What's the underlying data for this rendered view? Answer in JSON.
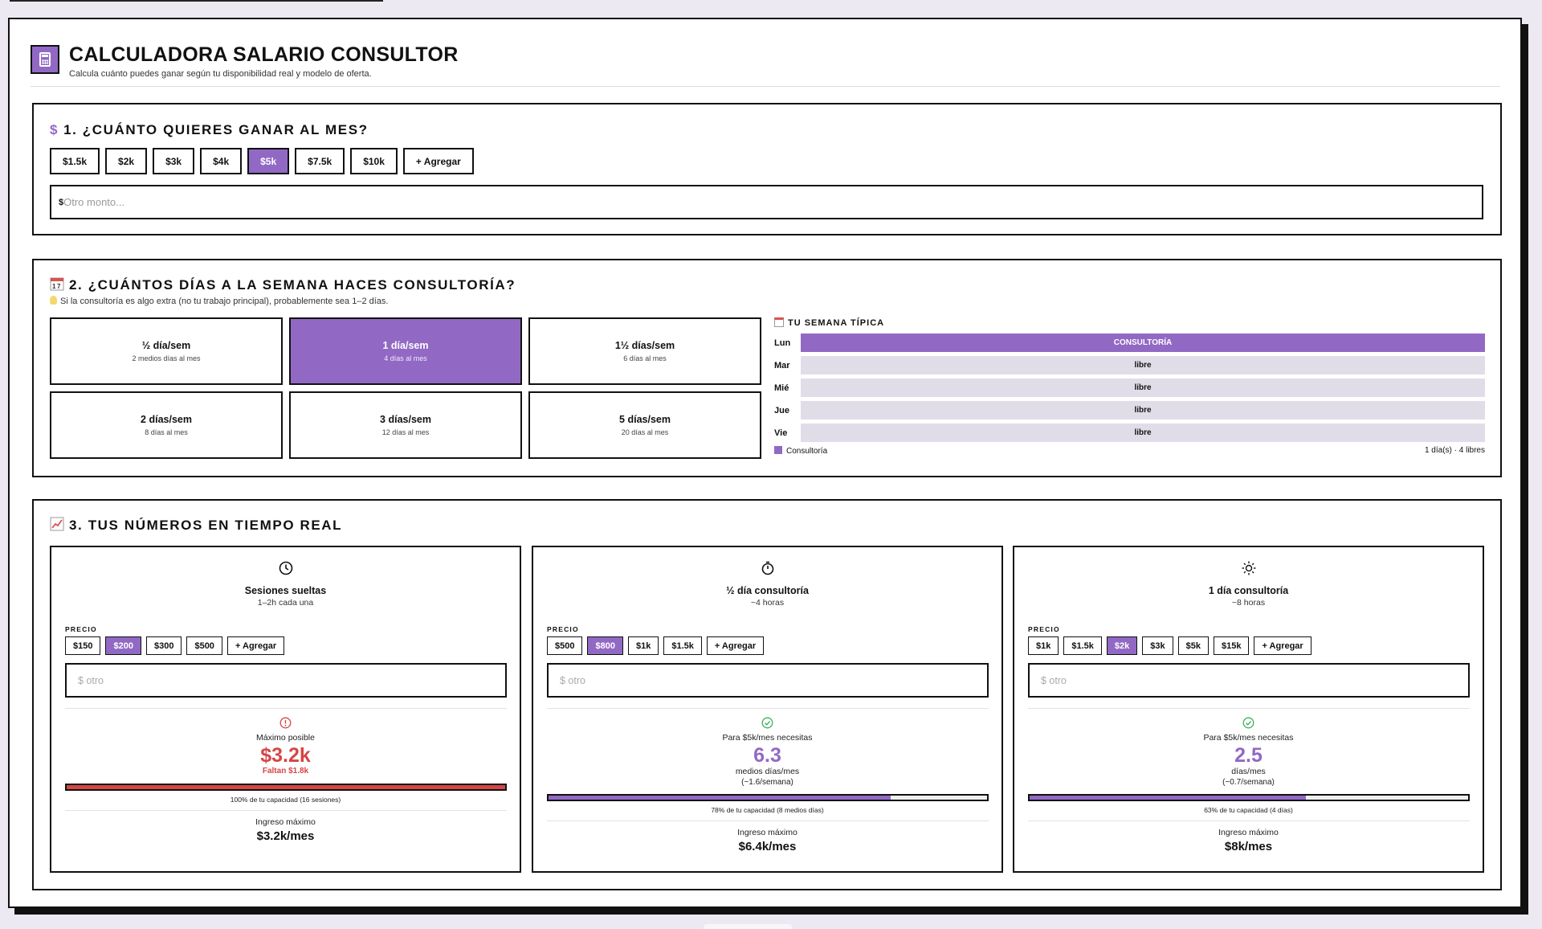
{
  "header": {
    "title": "CALCULADORA SALARIO CONSULTOR",
    "subtitle": "Calcula cuánto puedes ganar según tu disponibilidad real y modelo de oferta."
  },
  "section1": {
    "icon": "$",
    "title": "1. ¿CUÁNTO QUIERES GANAR AL MES?",
    "amounts": [
      "$1.5k",
      "$2k",
      "$3k",
      "$4k",
      "$5k",
      "$7.5k",
      "$10k"
    ],
    "selected": "$5k",
    "add_label": "+ Agregar",
    "input_prefix": "$",
    "input_placeholder": "Otro monto..."
  },
  "section2": {
    "title": "2. ¿CUÁNTOS DÍAS A LA SEMANA HACES CONSULTORÍA?",
    "hint": "Si la consultoría es algo extra (no tu trabajo principal), probablemente sea 1–2 días.",
    "options": [
      {
        "label": "½ día/sem",
        "sub": "2 medios días al mes"
      },
      {
        "label": "1 día/sem",
        "sub": "4 días al mes"
      },
      {
        "label": "1½ días/sem",
        "sub": "6 días al mes"
      },
      {
        "label": "2 días/sem",
        "sub": "8 días al mes"
      },
      {
        "label": "3 días/sem",
        "sub": "12 días al mes"
      },
      {
        "label": "5 días/sem",
        "sub": "20 días al mes"
      }
    ],
    "selected_index": 1,
    "week": {
      "title": "TU SEMANA TÍPICA",
      "days": [
        {
          "day": "Lun",
          "state": "CONSULTORÍA",
          "on": true
        },
        {
          "day": "Mar",
          "state": "libre",
          "on": false
        },
        {
          "day": "Mié",
          "state": "libre",
          "on": false
        },
        {
          "day": "Jue",
          "state": "libre",
          "on": false
        },
        {
          "day": "Vie",
          "state": "libre",
          "on": false
        }
      ],
      "legend": "Consultoría",
      "summary": "1 día(s) · 4 libres"
    }
  },
  "section3": {
    "title": "3. TUS NÚMEROS EN TIEMPO REAL",
    "precio_label": "PRECIO",
    "input_placeholder": "$ otro",
    "add_label": "+ Agregar",
    "ingreso_label": "Ingreso máximo",
    "cards": [
      {
        "icon": "clock-icon",
        "title": "Sesiones sueltas",
        "sub": "1–2h cada una",
        "prices": [
          "$150",
          "$200",
          "$300",
          "$500"
        ],
        "selected": "$200",
        "status": "warning",
        "headline": "Máximo posible",
        "value": "$3.2k",
        "faltan": "Faltan $1.8k",
        "unit": "",
        "unit_sub": "",
        "fill_percent": 100,
        "capacity": "100% de tu capacidad (16 sesiones)",
        "ingreso": "$3.2k/mes"
      },
      {
        "icon": "stopwatch-icon",
        "title": "½ día consultoría",
        "sub": "~4 horas",
        "prices": [
          "$500",
          "$800",
          "$1k",
          "$1.5k"
        ],
        "selected": "$800",
        "status": "ok",
        "headline": "Para $5k/mes necesitas",
        "value": "6.3",
        "faltan": "",
        "unit": "medios días/mes",
        "unit_sub": "(~1.6/semana)",
        "fill_percent": 78,
        "capacity": "78% de tu capacidad (8 medios días)",
        "ingreso": "$6.4k/mes"
      },
      {
        "icon": "sun-icon",
        "title": "1 día consultoría",
        "sub": "~8 horas",
        "prices": [
          "$1k",
          "$1.5k",
          "$2k",
          "$3k",
          "$5k",
          "$15k"
        ],
        "selected": "$2k",
        "status": "ok",
        "headline": "Para $5k/mes necesitas",
        "value": "2.5",
        "faltan": "",
        "unit": "días/mes",
        "unit_sub": "(~0.7/semana)",
        "fill_percent": 63,
        "capacity": "63% de tu capacidad (4 días)",
        "ingreso": "$8k/mes"
      }
    ]
  },
  "colors": {
    "accent": "#9169c4",
    "danger": "#d64545",
    "ok": "#3cb05a",
    "free": "#e1dde8"
  }
}
